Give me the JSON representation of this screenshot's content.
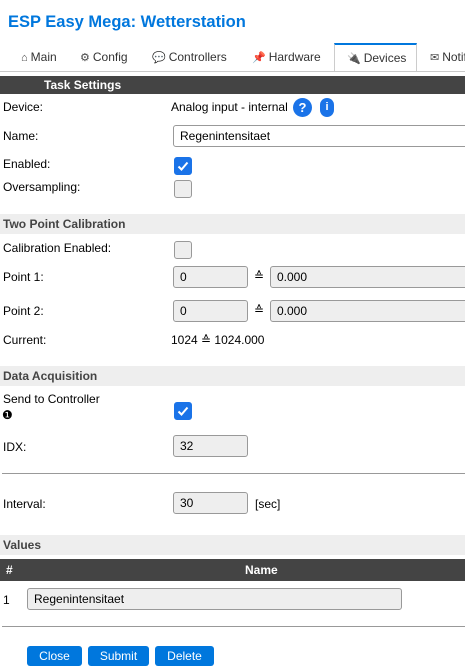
{
  "header": {
    "title": "ESP Easy Mega: Wetterstation"
  },
  "tabs": [
    {
      "label": "Main",
      "icon": "home-icon",
      "glyph": "⌂"
    },
    {
      "label": "Config",
      "icon": "gear-icon",
      "glyph": "⚙"
    },
    {
      "label": "Controllers",
      "icon": "chat-icon",
      "glyph": "💬"
    },
    {
      "label": "Hardware",
      "icon": "pin-icon",
      "glyph": "📌"
    },
    {
      "label": "Devices",
      "icon": "plug-icon",
      "glyph": "🔌",
      "active": true
    },
    {
      "label": "Notifi",
      "icon": "envelope-icon",
      "glyph": "✉"
    }
  ],
  "task_settings": {
    "header": "Task Settings",
    "device_label": "Device:",
    "device_value": "Analog input - internal",
    "help_glyph": "?",
    "info_glyph": "i",
    "name_label": "Name:",
    "name_value": "Regenintensitaet",
    "enabled_label": "Enabled:",
    "enabled": true,
    "oversampling_label": "Oversampling:",
    "oversampling": false
  },
  "calibration": {
    "header": "Two Point Calibration",
    "enabled_label": "Calibration Enabled:",
    "enabled": false,
    "point1_label": "Point 1:",
    "point1_adc": "0",
    "point1_value": "0.000",
    "point2_label": "Point 2:",
    "point2_adc": "0",
    "point2_value": "0.000",
    "approx_symbol": "≙",
    "current_label": "Current:",
    "current_value": "1024 ≙ 1024.000"
  },
  "acquisition": {
    "header": "Data Acquisition",
    "send_label": "Send to Controller",
    "send_marker": "❶",
    "send": true,
    "idx_label": "IDX:",
    "idx_value": "32",
    "interval_label": "Interval:",
    "interval_value": "30",
    "interval_unit": "[sec]"
  },
  "values": {
    "header": "Values",
    "col_num": "#",
    "col_name": "Name",
    "rows": [
      {
        "num": "1",
        "name": "Regenintensitaet"
      }
    ]
  },
  "buttons": {
    "close": "Close",
    "submit": "Submit",
    "delete": "Delete"
  },
  "colors": {
    "accent": "#0077dd",
    "header_dark": "#444444",
    "section_grey": "#eeeeee",
    "checkbox_on": "#1a73e8"
  }
}
